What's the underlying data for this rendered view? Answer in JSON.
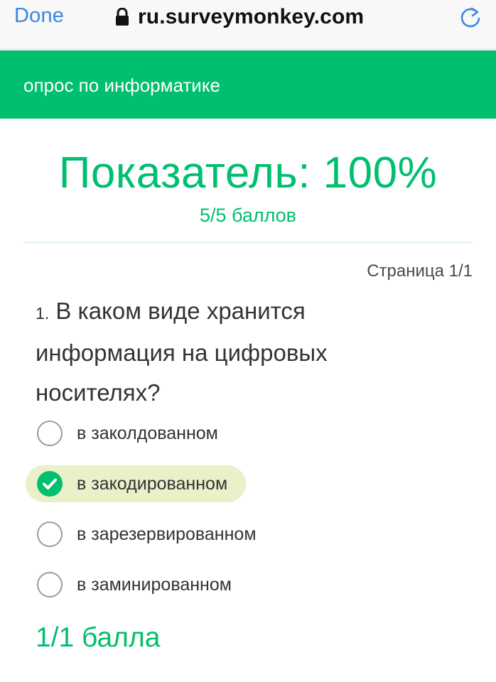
{
  "browser": {
    "done_label": "Done",
    "url": "ru.surveymonkey.com",
    "lock_icon": "lock-icon",
    "reload_icon": "reload-icon",
    "accent": "#3b86e0"
  },
  "survey": {
    "title": "опрос по информатике",
    "header_color": "#00bf6f"
  },
  "score": {
    "title": "Показатель: 100%",
    "points": "5/5 баллов"
  },
  "page_indicator": "Страница 1/1",
  "question": {
    "number": "1.",
    "text": "В каком виде хранится информация на цифровых носителях?",
    "options": [
      {
        "label": "в заколдованном",
        "selected": false
      },
      {
        "label": "в закодированном",
        "selected": true
      },
      {
        "label": "в зарезервированном",
        "selected": false
      },
      {
        "label": "в заминированном",
        "selected": false
      }
    ],
    "score": "1/1 балла"
  },
  "colors": {
    "brand_green": "#00bf6f",
    "selected_bg": "#eaf0c8"
  }
}
